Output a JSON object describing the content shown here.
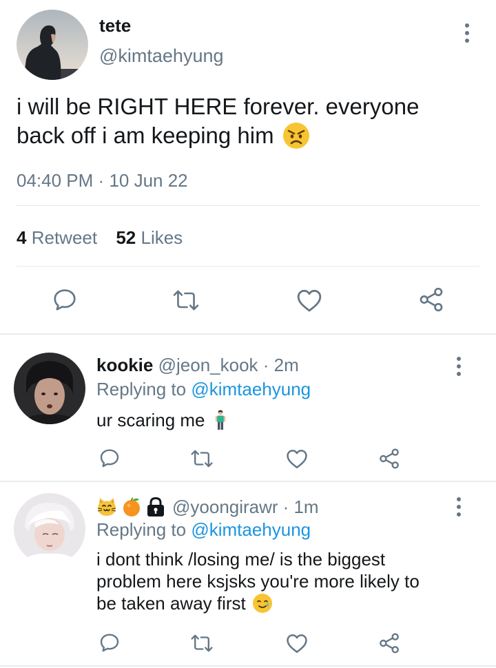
{
  "main_tweet": {
    "display_name": "tete",
    "handle": "@kimtaehyung",
    "text_line1": "i will be RIGHT HERE forever. everyone",
    "text_line2": "back off i am keeping him",
    "text_emoji": "angry-face-emoji",
    "time": "04:40 PM",
    "separator": "·",
    "date": "10 Jun 22",
    "retweet_count": "4",
    "retweet_label": "Retweet",
    "likes_count": "52",
    "likes_label": "Likes"
  },
  "replies": [
    {
      "display_name": "kookie",
      "handle": "@jeon_kook",
      "time": "· 2m",
      "replying_prefix": "Replying to",
      "replying_to": "@kimtaehyung",
      "text_lines": [
        "ur scaring me"
      ],
      "trailing_emoji": "standing-person-emoji"
    },
    {
      "name_emojis": [
        "cat-face-emoji",
        "tangerine-emoji",
        "lock-emoji"
      ],
      "handle": "@yoongirawr",
      "time": "· 1m",
      "replying_prefix": "Replying to",
      "replying_to": "@kimtaehyung",
      "text_lines": [
        "i dont think /losing me/ is the biggest",
        "problem here ksjsks you're more likely to",
        "be taken away first"
      ],
      "trailing_emoji": "smiling-face-with-tear-emoji"
    }
  ],
  "actions": [
    "reply-icon",
    "retweet-icon",
    "like-icon",
    "share-icon"
  ],
  "colors": {
    "text": "#14171a",
    "secondary": "#657786",
    "link": "#1b95e0",
    "divider": "#e1e8ed",
    "background": "#ffffff"
  }
}
